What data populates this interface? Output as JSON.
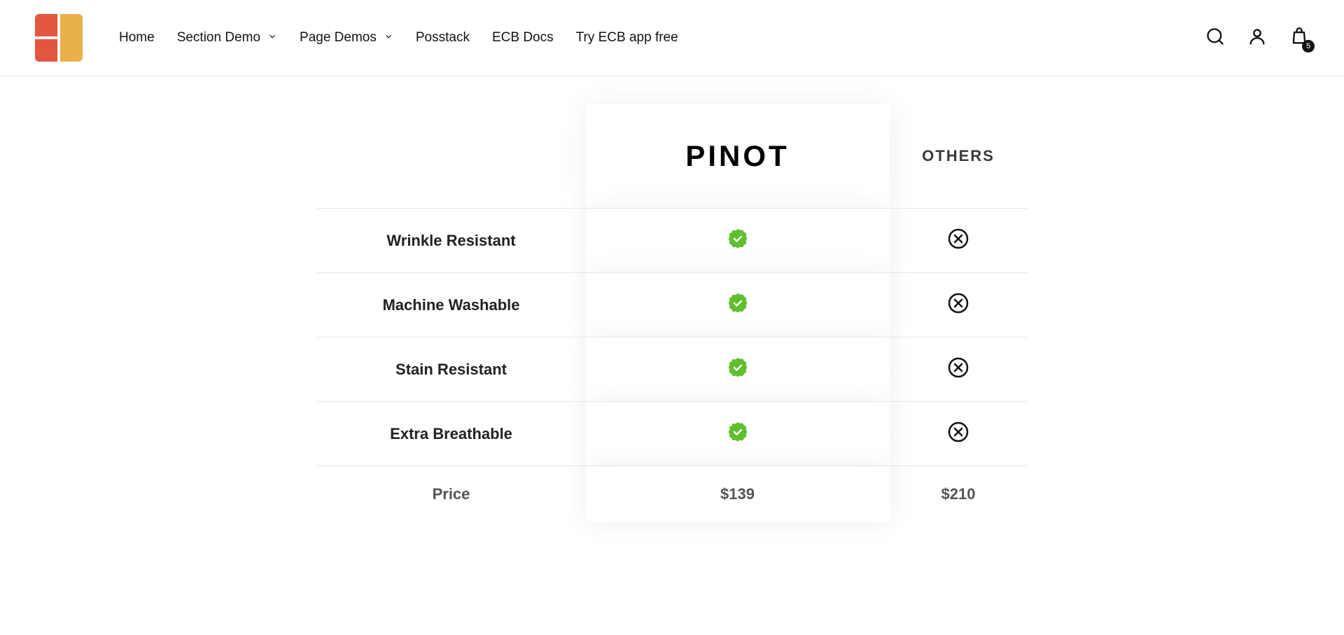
{
  "nav": {
    "items": [
      {
        "label": "Home",
        "dropdown": false
      },
      {
        "label": "Section Demo",
        "dropdown": true
      },
      {
        "label": "Page Demos",
        "dropdown": true
      },
      {
        "label": "Posstack",
        "dropdown": false
      },
      {
        "label": "ECB Docs",
        "dropdown": false
      },
      {
        "label": "Try ECB app free",
        "dropdown": false
      }
    ]
  },
  "cart_count": "5",
  "comparison": {
    "brand_logo_text": "PINOT",
    "others_label": "OTHERS",
    "rows": [
      {
        "label": "Wrinkle Resistant",
        "brand": "check",
        "other": "x"
      },
      {
        "label": "Machine Washable",
        "brand": "check",
        "other": "x"
      },
      {
        "label": "Stain Resistant",
        "brand": "check",
        "other": "x"
      },
      {
        "label": "Extra Breathable",
        "brand": "check",
        "other": "x"
      }
    ],
    "price_label": "Price",
    "brand_price": "$139",
    "other_price": "$210"
  }
}
